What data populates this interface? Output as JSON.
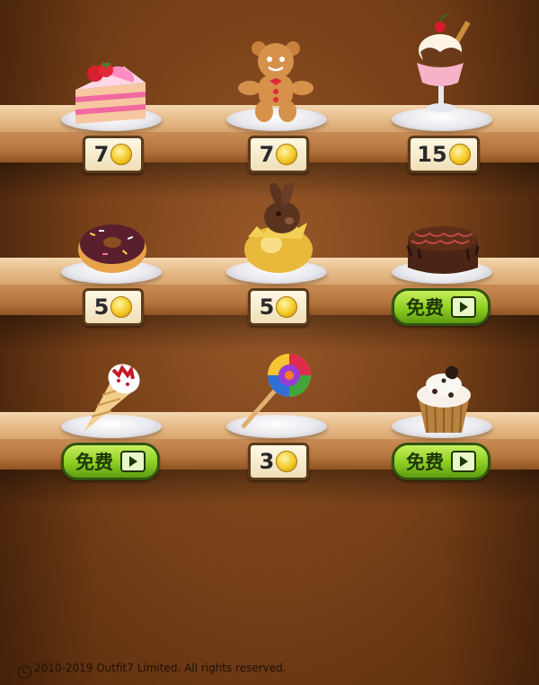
{
  "shop": {
    "items": [
      {
        "name": "layer-cake",
        "price": "7",
        "kind": "coins"
      },
      {
        "name": "gingerbread-man",
        "price": "7",
        "kind": "coins"
      },
      {
        "name": "ice-cream-sundae",
        "price": "15",
        "kind": "coins"
      },
      {
        "name": "donut",
        "price": "5",
        "kind": "coins"
      },
      {
        "name": "chocolate-bunny",
        "price": "5",
        "kind": "coins"
      },
      {
        "name": "chocolate-cake",
        "label": "免费",
        "kind": "free-video"
      },
      {
        "name": "ice-cream-cone",
        "label": "免费",
        "kind": "free-video"
      },
      {
        "name": "lollipop",
        "price": "3",
        "kind": "coins"
      },
      {
        "name": "cupcake",
        "label": "免费",
        "kind": "free-video"
      }
    ]
  },
  "footer": {
    "copyright": "2010-2019 Outfit7 Limited. All rights reserved."
  },
  "colors": {
    "background": "#7a4219",
    "shelf": "#e8bf8d",
    "free_button": "#8ccd22",
    "coin": "#f4c824"
  }
}
